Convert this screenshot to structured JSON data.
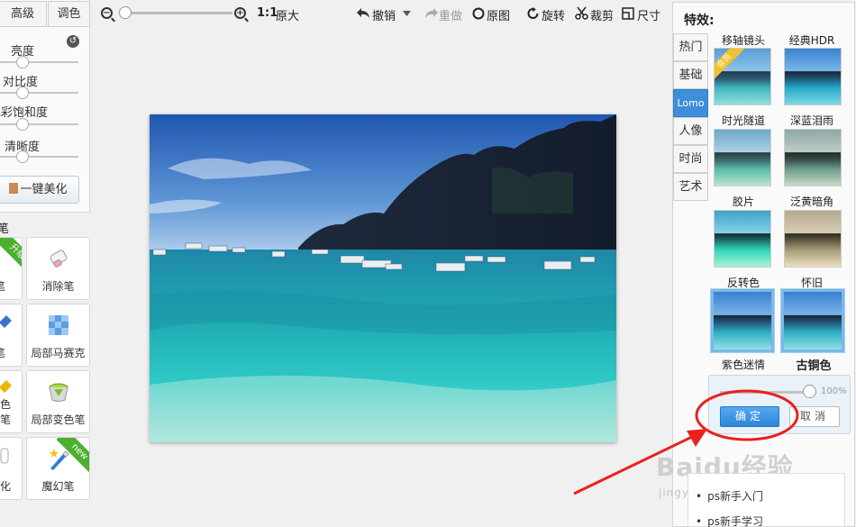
{
  "left": {
    "tabs": [
      "高级",
      "调色"
    ],
    "adjustments": [
      {
        "label": "亮度",
        "value": 0.25
      },
      {
        "label": "对比度",
        "value": 0.25
      },
      {
        "label": "色彩饱和度",
        "value": 0.25
      },
      {
        "label": "清晰度",
        "value": 0.25
      }
    ],
    "beauty_button": "一键美化",
    "pen_heading": "笔",
    "tools": [
      {
        "label": "笔",
        "badge": "升级"
      },
      {
        "label": "消除笔"
      },
      {
        "label": "笔"
      },
      {
        "label": "局部马赛克"
      },
      {
        "label": "色笔"
      },
      {
        "label": "局部变色笔"
      },
      {
        "label": "化"
      },
      {
        "label": "魔幻笔",
        "badge": "new"
      }
    ]
  },
  "toolbar": {
    "zoom_ratio": "1:1",
    "original_size": "原大",
    "undo": "撤销",
    "redo": "重做",
    "original": "原图",
    "rotate": "旋转",
    "crop": "裁剪",
    "size": "尺寸"
  },
  "effects": {
    "title": "特效:",
    "tabs": [
      "热门",
      "基础",
      "Lomo",
      "人像",
      "时尚",
      "艺术"
    ],
    "active_tab": "Lomo",
    "items": [
      {
        "label": "移轴镜头",
        "badge": "会员"
      },
      {
        "label": "经典HDR"
      },
      {
        "label": "时光隧道"
      },
      {
        "label": "深蓝泪雨"
      },
      {
        "label": "胶片"
      },
      {
        "label": "泛黄暗角"
      },
      {
        "label": "反转色"
      },
      {
        "label": "怀旧"
      },
      {
        "label": "紫色迷情"
      },
      {
        "label": "古铜色"
      }
    ],
    "strength_value": "100%",
    "ok": "确定",
    "cancel": "取消"
  },
  "links": [
    "ps新手入门",
    "ps新手学习"
  ],
  "watermark": {
    "main": "Baidu经验",
    "sub": "jingyan.baidu.com"
  },
  "colors": {
    "accent": "#3c8fd8",
    "annotation": "#e8221e"
  }
}
